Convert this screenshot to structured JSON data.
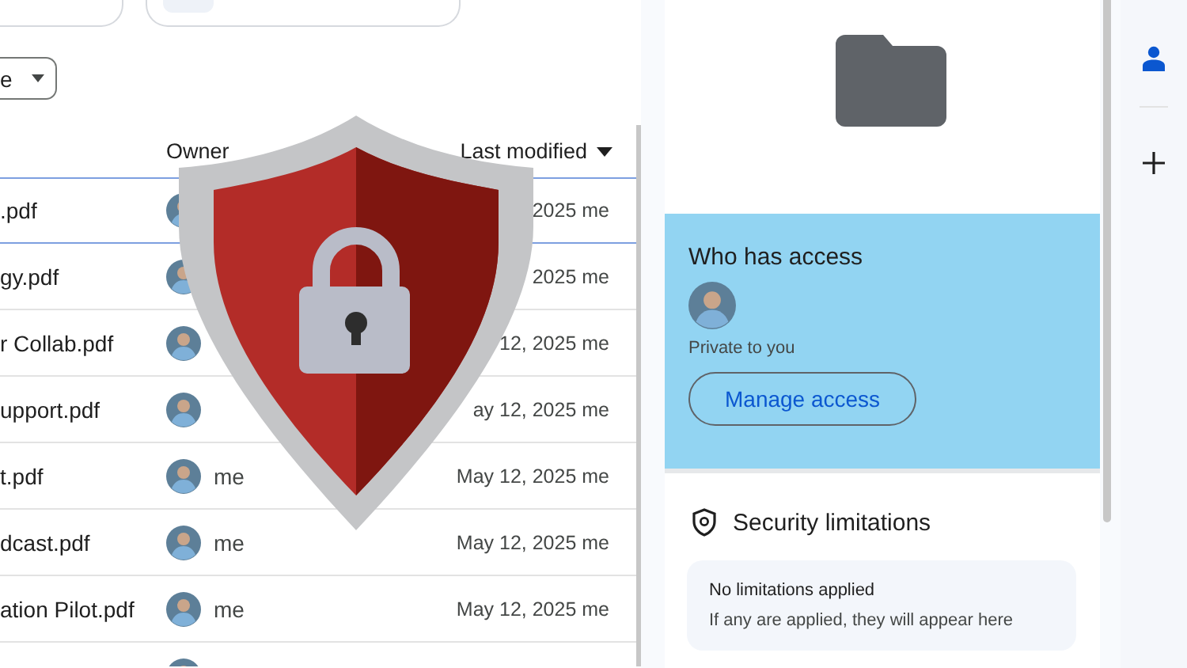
{
  "filter_chip": {
    "label": "e"
  },
  "table": {
    "columns": [
      {
        "label": "Owner"
      },
      {
        "label": "Last modified",
        "sorted": true
      }
    ],
    "rows": [
      {
        "name": ".pdf",
        "modified": "2025 me",
        "selected": true
      },
      {
        "name": "gy.pdf",
        "modified": "2025 me",
        "selected": false
      },
      {
        "name": "r Collab.pdf",
        "modified": "12, 2025 me",
        "selected": false
      },
      {
        "name": "upport.pdf",
        "modified": "ay 12, 2025 me",
        "selected": false
      },
      {
        "name": "t.pdf",
        "owner": "me",
        "modified": "May 12, 2025 me",
        "selected": false
      },
      {
        "name": "dcast.pdf",
        "owner": "me",
        "modified": "May 12, 2025 me",
        "selected": false
      },
      {
        "name": "ation Pilot.pdf",
        "owner": "me",
        "modified": "May 12, 2025 me",
        "selected": false
      },
      {
        "selected": false
      }
    ]
  },
  "details": {
    "access": {
      "title": "Who has access",
      "note": "Private to you",
      "button": "Manage access",
      "highlighted": true
    },
    "security": {
      "title": "Security limitations",
      "card_title": "No limitations applied",
      "card_text": "If any are applied, they will appear here"
    }
  }
}
